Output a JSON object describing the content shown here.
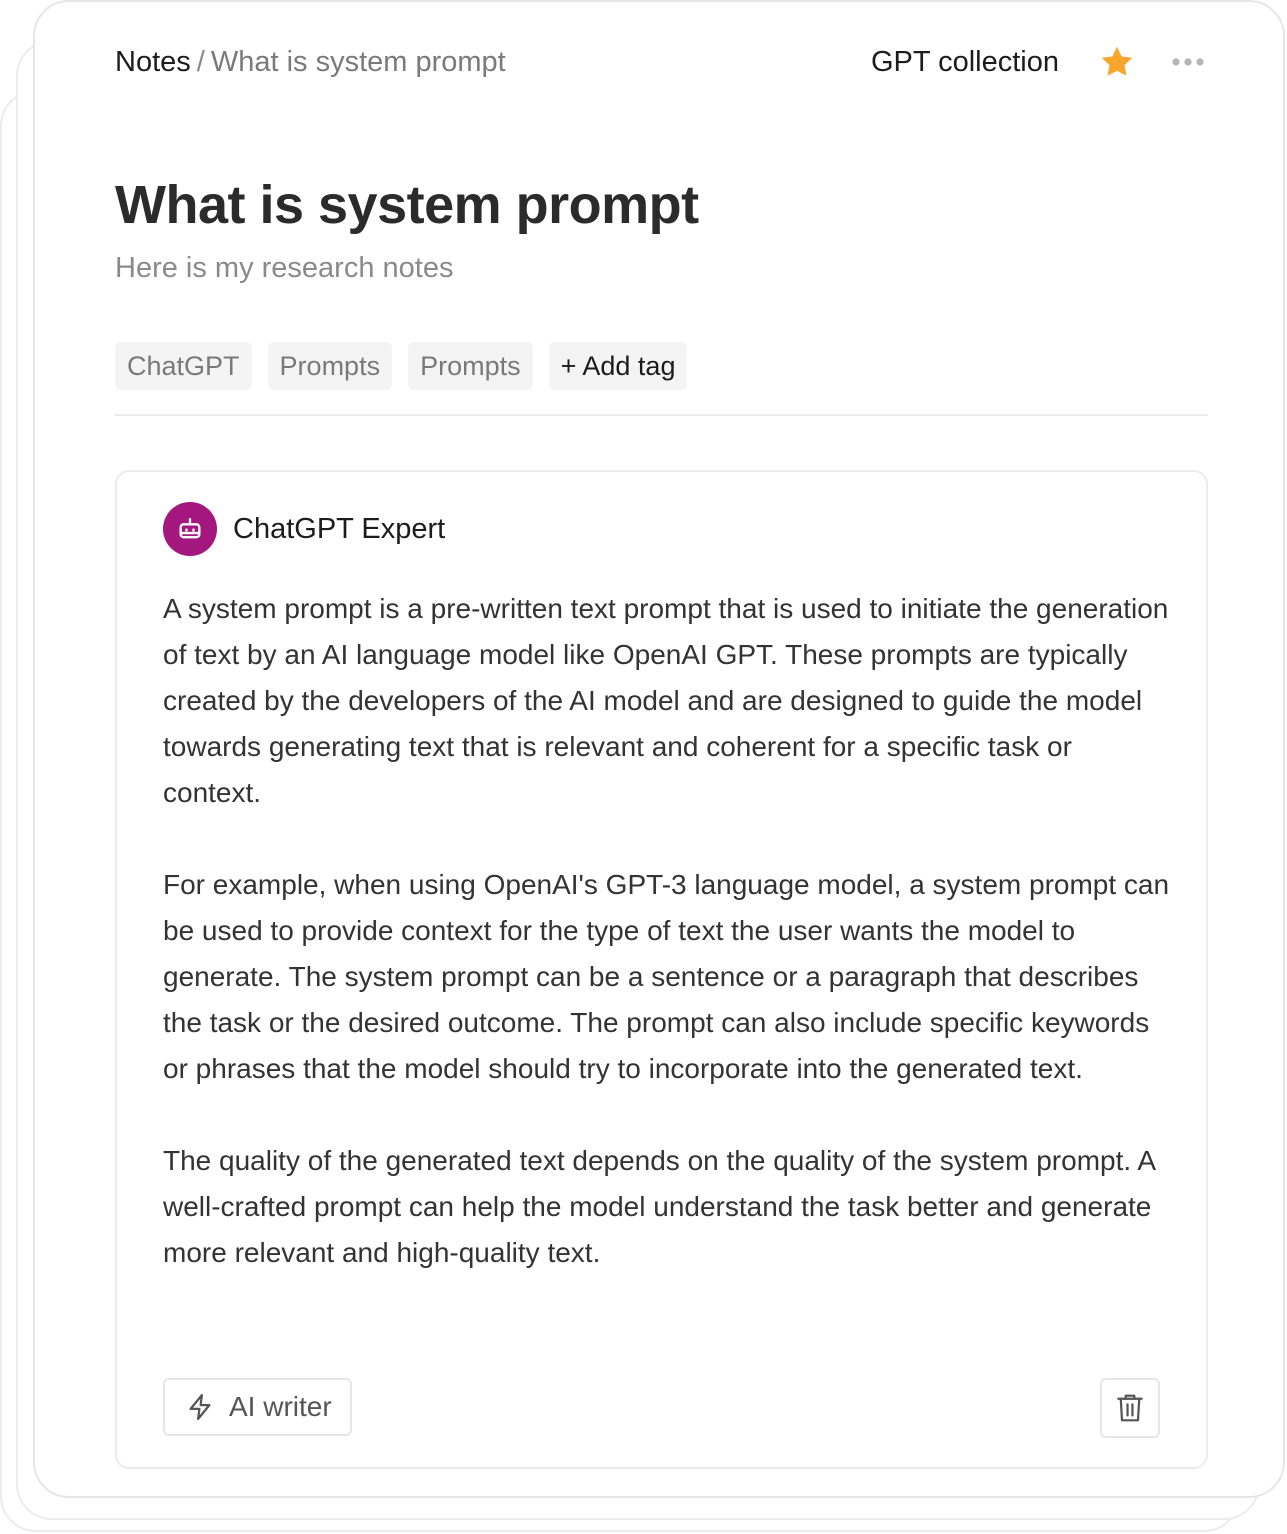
{
  "breadcrumb": {
    "root": "Notes",
    "separator": "/",
    "current": "What is system prompt"
  },
  "header": {
    "collection": "GPT collection",
    "favorite_icon": "star-icon",
    "favorite_color": "#F7A52B",
    "more_icon": "more-horizontal-icon"
  },
  "page": {
    "title": "What is system prompt",
    "subtitle": "Here is my research notes"
  },
  "tags": [
    "ChatGPT",
    "Prompts",
    "Prompts"
  ],
  "add_tag_label": "+ Add tag",
  "note": {
    "author": {
      "name": "ChatGPT Expert",
      "avatar_icon": "robot-icon",
      "avatar_color": "#A3177E"
    },
    "paragraphs": [
      "A system prompt is a pre-written text prompt that is used to initiate the generation of text by an AI language model like OpenAI GPT. These prompts are typically created by the developers of the AI model and are designed to guide the model towards generating text that is relevant and coherent for a specific task or context.",
      "For example, when using OpenAI's GPT-3 language model, a system prompt can be used to provide context for the type of text the user wants the model to generate. The system prompt can be a sentence or a paragraph that describes the task or the desired outcome. The prompt can also include specific keywords or phrases that the model should try to incorporate into the generated text.",
      "The quality of the generated text depends on the quality of the system prompt. A well-crafted prompt can help the model understand the task better and generate more relevant and high-quality text."
    ],
    "ai_writer_label": "AI writer",
    "ai_writer_icon": "lightning-icon",
    "delete_icon": "trash-icon"
  }
}
